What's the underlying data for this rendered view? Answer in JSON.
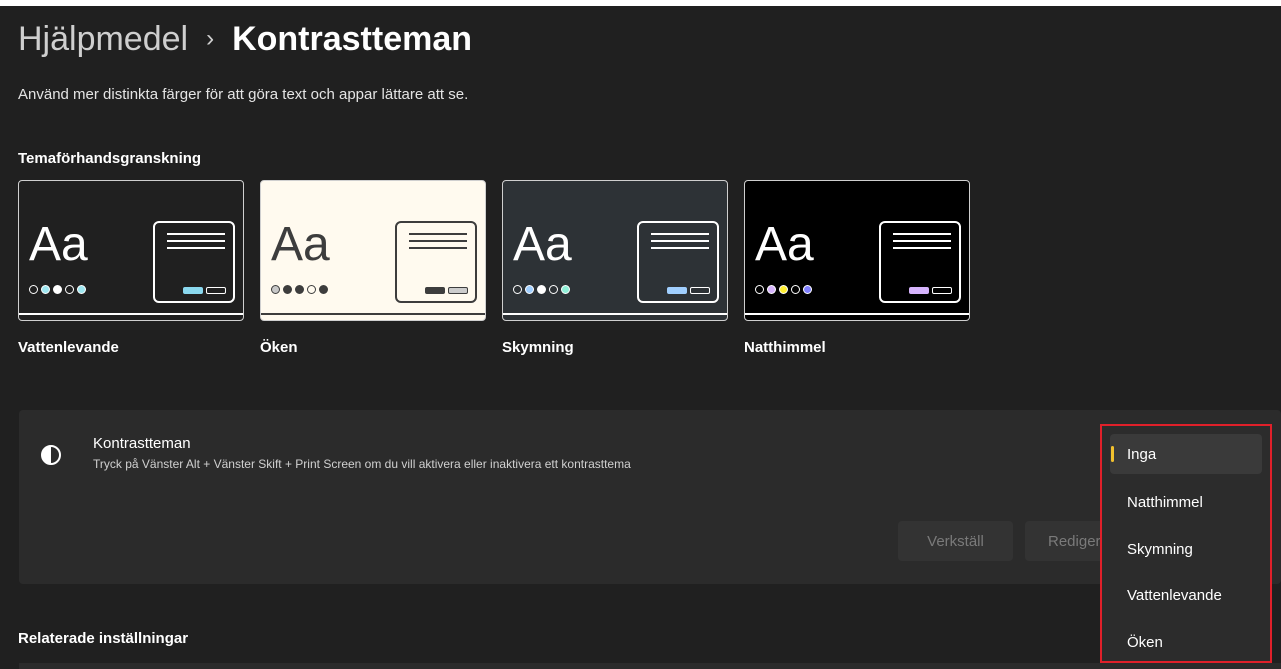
{
  "breadcrumb": {
    "parent": "Hjälpmedel",
    "separator": "›",
    "current": "Kontrastteman"
  },
  "subtitle": "Använd mer distinkta färger för att göra text och appar lättare att se.",
  "preview_section": {
    "title": "Temaförhandsgranskning",
    "sample_text": "Aa",
    "themes": [
      {
        "label": "Vattenlevande",
        "bg": "#202020",
        "fg": "#ffffff",
        "line": "#ffffff",
        "dots": [
          "#202020",
          "#9de6f0",
          "#ffffff",
          "#202020",
          "#9de6f0"
        ],
        "button1": "#8ad8ee",
        "button2": "#202020"
      },
      {
        "label": "Öken",
        "bg": "#fffaef",
        "fg": "#3d3d3d",
        "line": "#3d3d3d",
        "dots": [
          "#c8c8c8",
          "#3d3d3d",
          "#3d3d3d",
          "#fffaef",
          "#3d3d3d"
        ],
        "button1": "#3d3d3d",
        "button2": "#cccccc"
      },
      {
        "label": "Skymning",
        "bg": "#2d3236",
        "fg": "#ffffff",
        "line": "#ffffff",
        "dots": [
          "#2d3236",
          "#a0cfff",
          "#ffffff",
          "#2d3236",
          "#8ff0d8"
        ],
        "button1": "#a0cfff",
        "button2": "#2d3236"
      },
      {
        "label": "Natthimmel",
        "bg": "#000000",
        "fg": "#ffffff",
        "line": "#ffffff",
        "dots": [
          "#000000",
          "#d6b4fd",
          "#ffee32",
          "#000000",
          "#8080ff"
        ],
        "button1": "#d6b4fd",
        "button2": "#000000"
      }
    ]
  },
  "contrast_panel": {
    "title": "Kontrastteman",
    "description": "Tryck på Vänster Alt + Vänster Skift + Print Screen om du vill aktivera eller inaktivera ett kontrasttema",
    "apply_label": "Verkställ",
    "edit_label": "Redigera"
  },
  "dropdown": {
    "selected_index": 0,
    "options": [
      "Inga",
      "Natthimmel",
      "Skymning",
      "Vattenlevande",
      "Öken"
    ],
    "highlight_color": "#e0202a",
    "accent_color": "#f2c12e"
  },
  "related_section": {
    "title": "Relaterade inställningar"
  }
}
